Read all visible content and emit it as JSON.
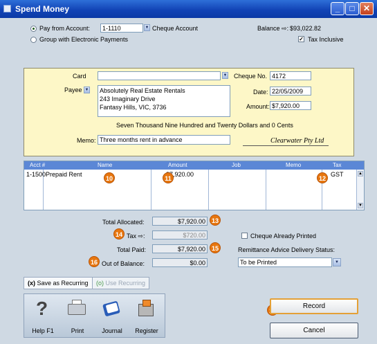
{
  "window": {
    "title": "Spend Money"
  },
  "pay_from": {
    "option_label": "Pay from Account:",
    "account_no": "1-1110",
    "account_name": "Cheque Account",
    "group_label": "Group with Electronic Payments",
    "balance_label": "Balance ⇨:",
    "balance_value": "$93,022.82",
    "tax_inclusive_label": "Tax Inclusive",
    "tax_inclusive_checked": true
  },
  "cheque": {
    "card_label": "Card",
    "card_value": "",
    "cheque_no_label": "Cheque No.",
    "cheque_no": "4172",
    "payee_label": "Payee",
    "payee_lines": [
      "Absolutely Real Estate Rentals",
      "243 Imaginary Drive",
      "Fantasy Hills, VIC, 3736"
    ],
    "date_label": "Date:",
    "date": "22/05/2009",
    "amount_label": "Amount:",
    "amount": "$7,920.00",
    "amount_words": "Seven Thousand Nine Hundred and Twenty Dollars and 0 Cents",
    "memo_label": "Memo:",
    "memo": "Three months rent in advance",
    "signature": "Clearwater Pty Ltd"
  },
  "grid": {
    "headers": [
      "Acct #",
      "Name",
      "Amount",
      "Job",
      "Memo",
      "Tax"
    ],
    "rows": [
      {
        "acct": "1-1500",
        "name": "Prepaid Rent",
        "amount": "$7,920.00",
        "job": "",
        "memo": "",
        "tax": "GST"
      }
    ]
  },
  "totals": {
    "allocated_label": "Total Allocated:",
    "allocated": "$7,920.00",
    "tax_label": "Tax ⇨:",
    "tax": "$720.00",
    "paid_label": "Total Paid:",
    "paid": "$7,920.00",
    "oob_label": "Out of Balance:",
    "oob": "$0.00"
  },
  "options": {
    "cheque_printed_label": "Cheque Already Printed",
    "remittance_label": "Remittance Advice Delivery Status:",
    "remittance_value": "To be Printed"
  },
  "recurring": {
    "save_label": "Save as Recurring",
    "use_label": "Use Recurring"
  },
  "toolbar": {
    "help": "Help F1",
    "print": "Print",
    "journal": "Journal",
    "register": "Register"
  },
  "buttons": {
    "record": "Record",
    "cancel": "Cancel"
  },
  "callouts": [
    "10",
    "11",
    "12",
    "13",
    "14",
    "15",
    "16",
    "17"
  ],
  "colors": {
    "title_bar": "#1244b6",
    "cheque_bg": "#fdf7c7",
    "grid_header": "#5b87d6",
    "callout": "#e7760e"
  }
}
